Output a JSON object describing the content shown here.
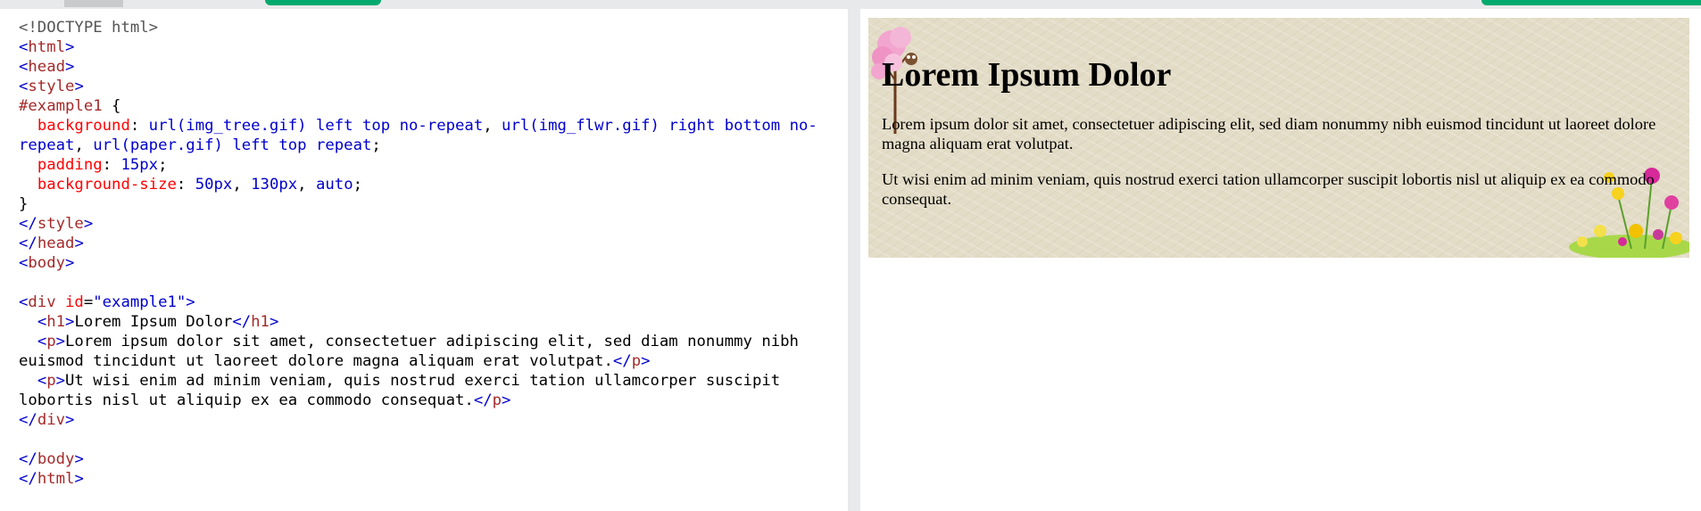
{
  "editor": {
    "lines": [
      [
        {
          "c": "doc",
          "t": "<!DOCTYPE html>"
        }
      ],
      [
        {
          "c": "br",
          "t": "<"
        },
        {
          "c": "tag",
          "t": "html"
        },
        {
          "c": "br",
          "t": ">"
        }
      ],
      [
        {
          "c": "br",
          "t": "<"
        },
        {
          "c": "tag",
          "t": "head"
        },
        {
          "c": "br",
          "t": ">"
        }
      ],
      [
        {
          "c": "br",
          "t": "<"
        },
        {
          "c": "tag",
          "t": "style"
        },
        {
          "c": "br",
          "t": ">"
        }
      ],
      [
        {
          "c": "sel",
          "t": "#example1"
        },
        {
          "c": "text",
          "t": " {"
        }
      ],
      [
        {
          "c": "text",
          "t": "  "
        },
        {
          "c": "prop",
          "t": "background"
        },
        {
          "c": "text",
          "t": ": "
        },
        {
          "c": "val",
          "t": "url(img_tree.gif) left top no-repeat"
        },
        {
          "c": "text",
          "t": ", "
        },
        {
          "c": "val",
          "t": "url(img_flwr.gif) right bottom no-"
        }
      ],
      [
        {
          "c": "val",
          "t": "repeat"
        },
        {
          "c": "text",
          "t": ", "
        },
        {
          "c": "val",
          "t": "url(paper.gif) left top repeat"
        },
        {
          "c": "text",
          "t": ";"
        }
      ],
      [
        {
          "c": "text",
          "t": "  "
        },
        {
          "c": "prop",
          "t": "padding"
        },
        {
          "c": "text",
          "t": ": "
        },
        {
          "c": "val",
          "t": "15px"
        },
        {
          "c": "text",
          "t": ";"
        }
      ],
      [
        {
          "c": "text",
          "t": "  "
        },
        {
          "c": "prop",
          "t": "background-size"
        },
        {
          "c": "text",
          "t": ": "
        },
        {
          "c": "val",
          "t": "50px"
        },
        {
          "c": "text",
          "t": ", "
        },
        {
          "c": "val",
          "t": "130px"
        },
        {
          "c": "text",
          "t": ", "
        },
        {
          "c": "val",
          "t": "auto"
        },
        {
          "c": "text",
          "t": ";"
        }
      ],
      [
        {
          "c": "text",
          "t": "}"
        }
      ],
      [
        {
          "c": "br",
          "t": "</"
        },
        {
          "c": "tag",
          "t": "style"
        },
        {
          "c": "br",
          "t": ">"
        }
      ],
      [
        {
          "c": "br",
          "t": "</"
        },
        {
          "c": "tag",
          "t": "head"
        },
        {
          "c": "br",
          "t": ">"
        }
      ],
      [
        {
          "c": "br",
          "t": "<"
        },
        {
          "c": "tag",
          "t": "body"
        },
        {
          "c": "br",
          "t": ">"
        }
      ],
      [],
      [
        {
          "c": "br",
          "t": "<"
        },
        {
          "c": "tag",
          "t": "div"
        },
        {
          "c": "text",
          "t": " "
        },
        {
          "c": "attr",
          "t": "id"
        },
        {
          "c": "text",
          "t": "="
        },
        {
          "c": "str",
          "t": "\"example1\""
        },
        {
          "c": "br",
          "t": ">"
        }
      ],
      [
        {
          "c": "text",
          "t": "  "
        },
        {
          "c": "br",
          "t": "<"
        },
        {
          "c": "tag",
          "t": "h1"
        },
        {
          "c": "br",
          "t": ">"
        },
        {
          "c": "text",
          "t": "Lorem Ipsum Dolor"
        },
        {
          "c": "br",
          "t": "</"
        },
        {
          "c": "tag",
          "t": "h1"
        },
        {
          "c": "br",
          "t": ">"
        }
      ],
      [
        {
          "c": "text",
          "t": "  "
        },
        {
          "c": "br",
          "t": "<"
        },
        {
          "c": "tag",
          "t": "p"
        },
        {
          "c": "br",
          "t": ">"
        },
        {
          "c": "text",
          "t": "Lorem ipsum dolor sit amet, consectetuer adipiscing elit, sed diam nonummy nibh"
        }
      ],
      [
        {
          "c": "text",
          "t": "euismod tincidunt ut laoreet dolore magna aliquam erat volutpat."
        },
        {
          "c": "br",
          "t": "</"
        },
        {
          "c": "tag",
          "t": "p"
        },
        {
          "c": "br",
          "t": ">"
        }
      ],
      [
        {
          "c": "text",
          "t": "  "
        },
        {
          "c": "br",
          "t": "<"
        },
        {
          "c": "tag",
          "t": "p"
        },
        {
          "c": "br",
          "t": ">"
        },
        {
          "c": "text",
          "t": "Ut wisi enim ad minim veniam, quis nostrud exerci tation ullamcorper suscipit"
        }
      ],
      [
        {
          "c": "text",
          "t": "lobortis nisl ut aliquip ex ea commodo consequat."
        },
        {
          "c": "br",
          "t": "</"
        },
        {
          "c": "tag",
          "t": "p"
        },
        {
          "c": "br",
          "t": ">"
        }
      ],
      [
        {
          "c": "br",
          "t": "</"
        },
        {
          "c": "tag",
          "t": "div"
        },
        {
          "c": "br",
          "t": ">"
        }
      ],
      [],
      [
        {
          "c": "br",
          "t": "</"
        },
        {
          "c": "tag",
          "t": "body"
        },
        {
          "c": "br",
          "t": ">"
        }
      ],
      [
        {
          "c": "br",
          "t": "</"
        },
        {
          "c": "tag",
          "t": "html"
        },
        {
          "c": "br",
          "t": ">"
        }
      ]
    ]
  },
  "preview": {
    "heading": "Lorem Ipsum Dolor",
    "paragraph_1": "Lorem ipsum dolor sit amet, consectetuer adipiscing elit, sed diam nonummy nibh euismod tincidunt ut laoreet dolore magna aliquam erat volutpat.",
    "paragraph_2": "Ut wisi enim ad minim veniam, quis nostrud exerci tation ullamcorper suscipit lobortis nisl ut aliquip ex ea commodo consequat."
  },
  "colors": {
    "accent_green": "#04aa6d",
    "tag": "#a52a2a",
    "bracket": "#0000cd",
    "property": "#ff0000",
    "value": "#0000cd",
    "paper": "#e3dcc7"
  },
  "icons": [
    "tree-image",
    "flower-image"
  ]
}
